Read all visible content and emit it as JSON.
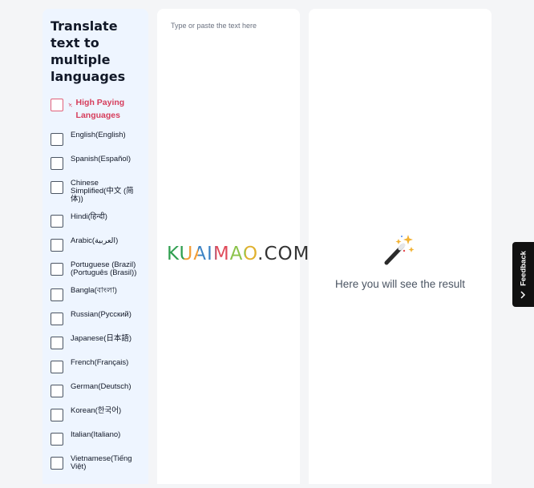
{
  "sidebar": {
    "title": "Translate text to multiple languages",
    "languages": [
      {
        "label": "High Paying Languages",
        "highlight": true
      },
      {
        "label": "English(English)"
      },
      {
        "label": "Spanish(Español)"
      },
      {
        "label": "Chinese Simplified(中文 (简体))"
      },
      {
        "label": "Hindi(हिन्दी)"
      },
      {
        "label": "Arabic(العربية)"
      },
      {
        "label": "Portuguese (Brazil)(Português (Brasil))"
      },
      {
        "label": "Bangla(বাংলা)"
      },
      {
        "label": "Russian(Русский)"
      },
      {
        "label": "Japanese(日本語)"
      },
      {
        "label": "French(Français)"
      },
      {
        "label": "German(Deutsch)"
      },
      {
        "label": "Korean(한국어)"
      },
      {
        "label": "Italian(Italiano)"
      },
      {
        "label": "Vietnamese(Tiếng Việt)"
      }
    ]
  },
  "input": {
    "placeholder": "Type or paste the text here",
    "value": ""
  },
  "result": {
    "placeholder": "Here you will see the result",
    "icon": "magic-wand-icon"
  },
  "watermark": {
    "text": "KUAIMAO.COM"
  },
  "feedback": {
    "label": "Feedback",
    "icon": "chevron-right-icon"
  },
  "colors": {
    "sidebar_bg": "#eef5ff",
    "highlight": "#d63d5c",
    "page_bg": "#f4f5f7",
    "feedback_bg": "#111111"
  }
}
